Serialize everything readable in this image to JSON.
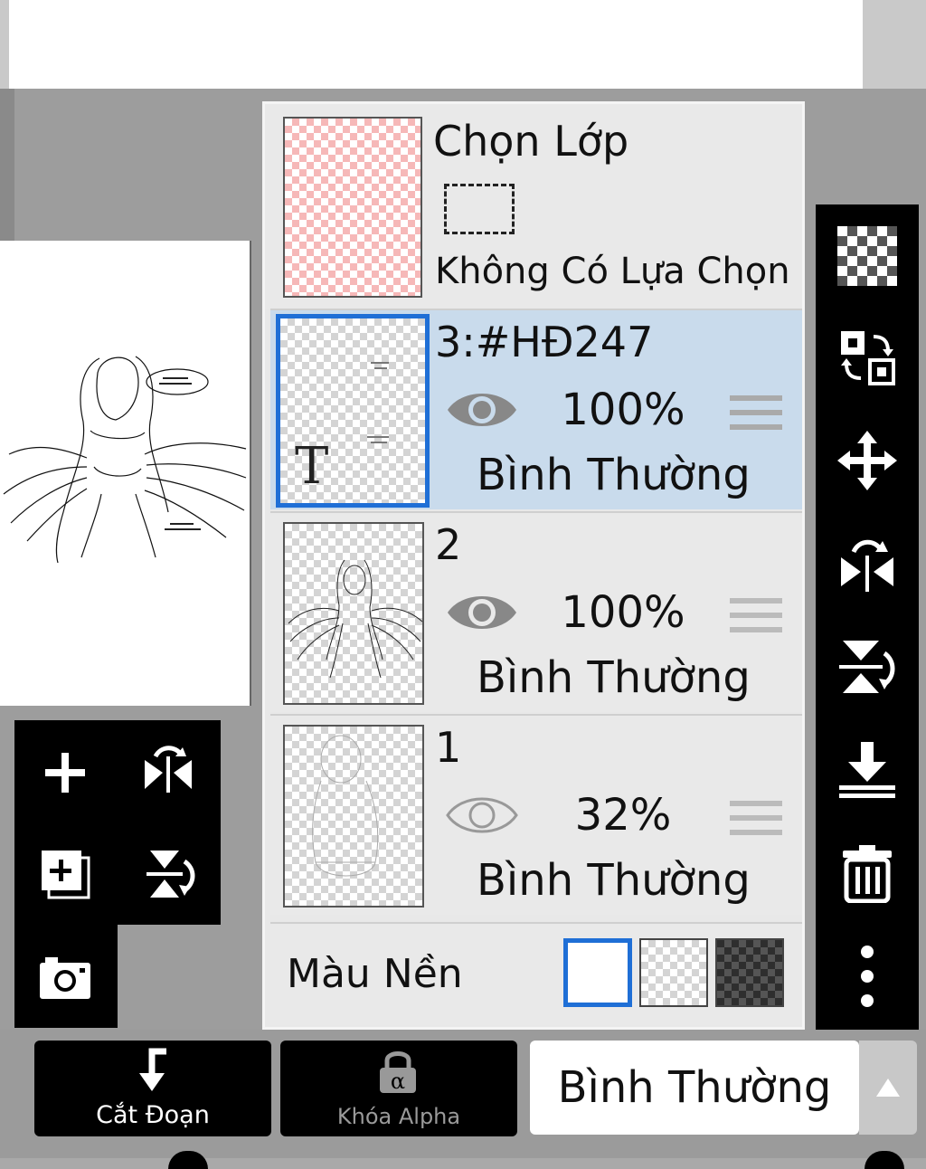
{
  "selection": {
    "title": "Chọn Lớp",
    "status": "Không Có Lựa Chọn"
  },
  "layers": [
    {
      "name": "3:#HĐ247",
      "opacity": "100%",
      "blend": "Bình Thường",
      "visible": true,
      "active": true,
      "text_layer_mark": "T"
    },
    {
      "name": "2",
      "opacity": "100%",
      "blend": "Bình Thường",
      "visible": true,
      "active": false
    },
    {
      "name": "1",
      "opacity": "32%",
      "blend": "Bình Thường",
      "visible": true,
      "active": false
    }
  ],
  "background": {
    "label": "Màu Nền",
    "options": [
      "white",
      "transparent",
      "dark-checker"
    ],
    "selected": "white"
  },
  "bottom": {
    "clip_label": "Cắt Đoạn",
    "alpha_lock_label": "Khóa Alpha",
    "blend_mode": "Bình Thường"
  },
  "colors": {
    "accent": "#1f6fd6",
    "active_layer": "#c9dbec",
    "selection_checker": "#f6b8b8"
  }
}
